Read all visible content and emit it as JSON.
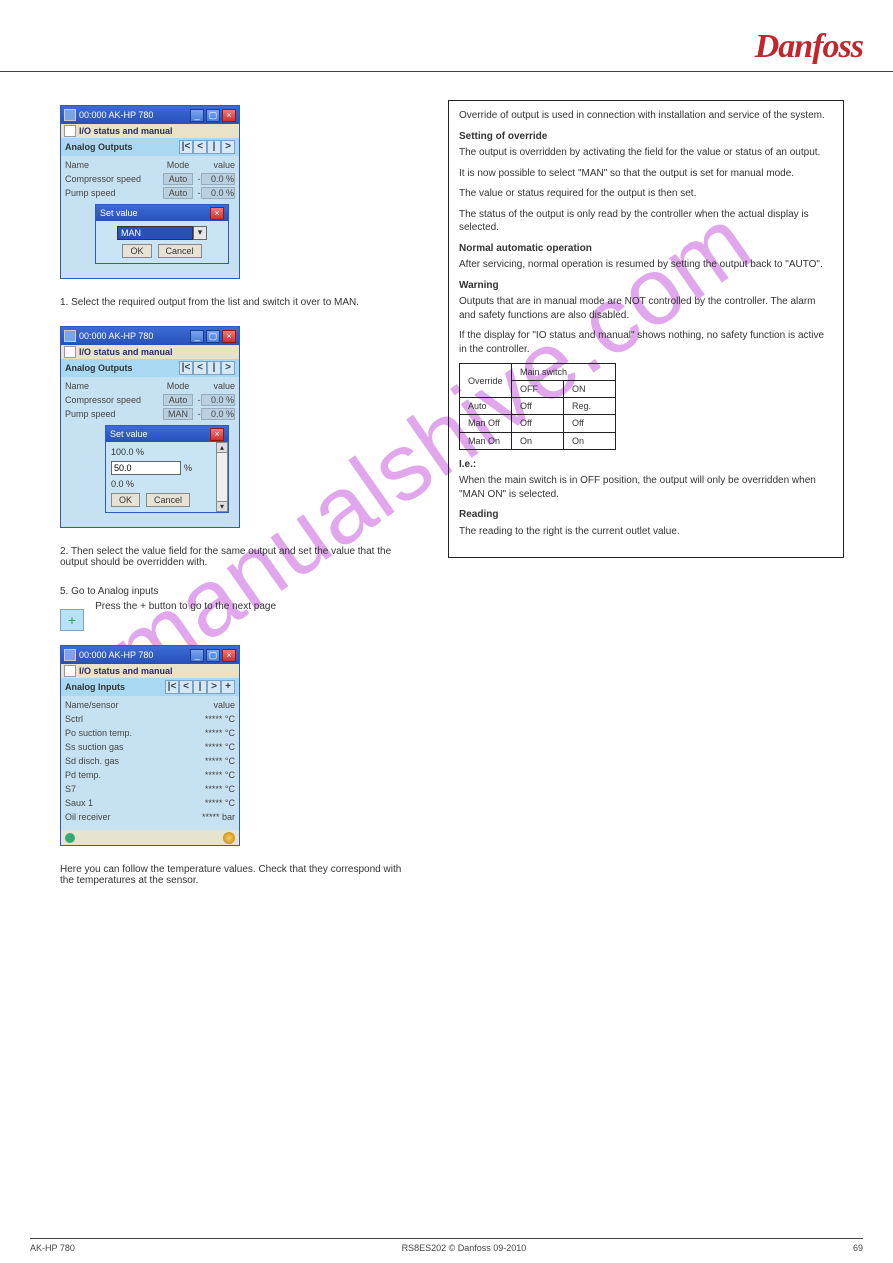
{
  "brand": "Danfoss",
  "footer": {
    "left": "AK-HP 780",
    "center": "RS8ES202 © Danfoss  09-2010",
    "right": "69"
  },
  "watermark": "manualshive.com",
  "right_box": {
    "p1": "Override of output is used in connection with installation and service of the system.",
    "h1": "Setting of override",
    "p2": "The output is overridden by activating the field for the value or status of an output.",
    "p3": "It is now possible to select \"MAN\" so that the output is set for manual mode.",
    "p4": "The value or status required for the output is then set.",
    "p5": "The status of the output is only read by the controller when the actual display is selected.",
    "h2": "Normal automatic operation",
    "p6": "After servicing, normal operation is resumed by setting the output back to \"AUTO\".",
    "h3": "Warning",
    "p7": "Outputs that are in manual mode are NOT controlled by the controller. The alarm and safety functions are also disabled.",
    "p8": "If the display for \"IO status and manual\" shows nothing, no safety function is active in the controller.",
    "table": {
      "head": [
        "",
        "Main switch"
      ],
      "subhead": [
        "",
        "OFF",
        "ON"
      ],
      "rows": [
        [
          "Override",
          "",
          ""
        ],
        [
          "Auto",
          "Off",
          "Reg."
        ],
        [
          "Man Off",
          "Off",
          "Off"
        ],
        [
          "Man On",
          "On",
          "On"
        ]
      ]
    },
    "h4": "I.e.:",
    "p9": "When the main switch is in OFF position, the output will only be overridden when \"MAN ON\" is selected.",
    "h5": "Reading",
    "p10": "The reading to the right is the current outlet value."
  },
  "win_common": {
    "title": "00:000 AK-HP 780",
    "subtitle": "I/O status and manual"
  },
  "win1": {
    "panel": "Analog Outputs",
    "head_name": "Name",
    "head_mode": "Mode",
    "head_val": "value",
    "rows": [
      {
        "name": "Compressor speed",
        "mode": "Auto",
        "val": "0.0 %"
      },
      {
        "name": "Pump speed",
        "mode": "Auto",
        "val": "0.0 %"
      }
    ],
    "dlg_title": "Set value",
    "combo_value": "MAN",
    "ok": "OK",
    "cancel": "Cancel"
  },
  "cap1": "1. Select the required output from the list and switch it over to MAN.",
  "win2": {
    "rows": [
      {
        "name": "Compressor speed",
        "mode": "Auto",
        "val": "0.0 %"
      },
      {
        "name": "Pump speed",
        "mode": "MAN",
        "val": "0.0 %"
      }
    ],
    "dlg_title": "Set value",
    "line_top": "100.0 %",
    "input_val": "50.0",
    "unit": "%",
    "line_bot": "0.0 %",
    "ok": "OK",
    "cancel": "Cancel"
  },
  "cap2": "2. Then select the value field for the same output and set the value that the output should be overridden with.",
  "step5": "5. Go to Analog inputs",
  "step5b": "Press the + button to go to the next page",
  "win3": {
    "panel": "Analog Inputs",
    "head_name": "Name/sensor",
    "head_val": "value",
    "rows": [
      {
        "name": "Sctrl",
        "val": "***** °C"
      },
      {
        "name": "Po suction temp.",
        "val": "***** °C"
      },
      {
        "name": "Ss suction gas",
        "val": "***** °C"
      },
      {
        "name": "Sd disch. gas",
        "val": "***** °C"
      },
      {
        "name": "Pd temp.",
        "val": "***** °C"
      },
      {
        "name": "S7",
        "val": "***** °C"
      },
      {
        "name": "Saux 1",
        "val": "***** °C"
      },
      {
        "name": "Oil receiver",
        "val": "***** bar"
      }
    ]
  },
  "cap3": "Here you can follow the temperature values. Check that they correspond with the temperatures at the sensor."
}
